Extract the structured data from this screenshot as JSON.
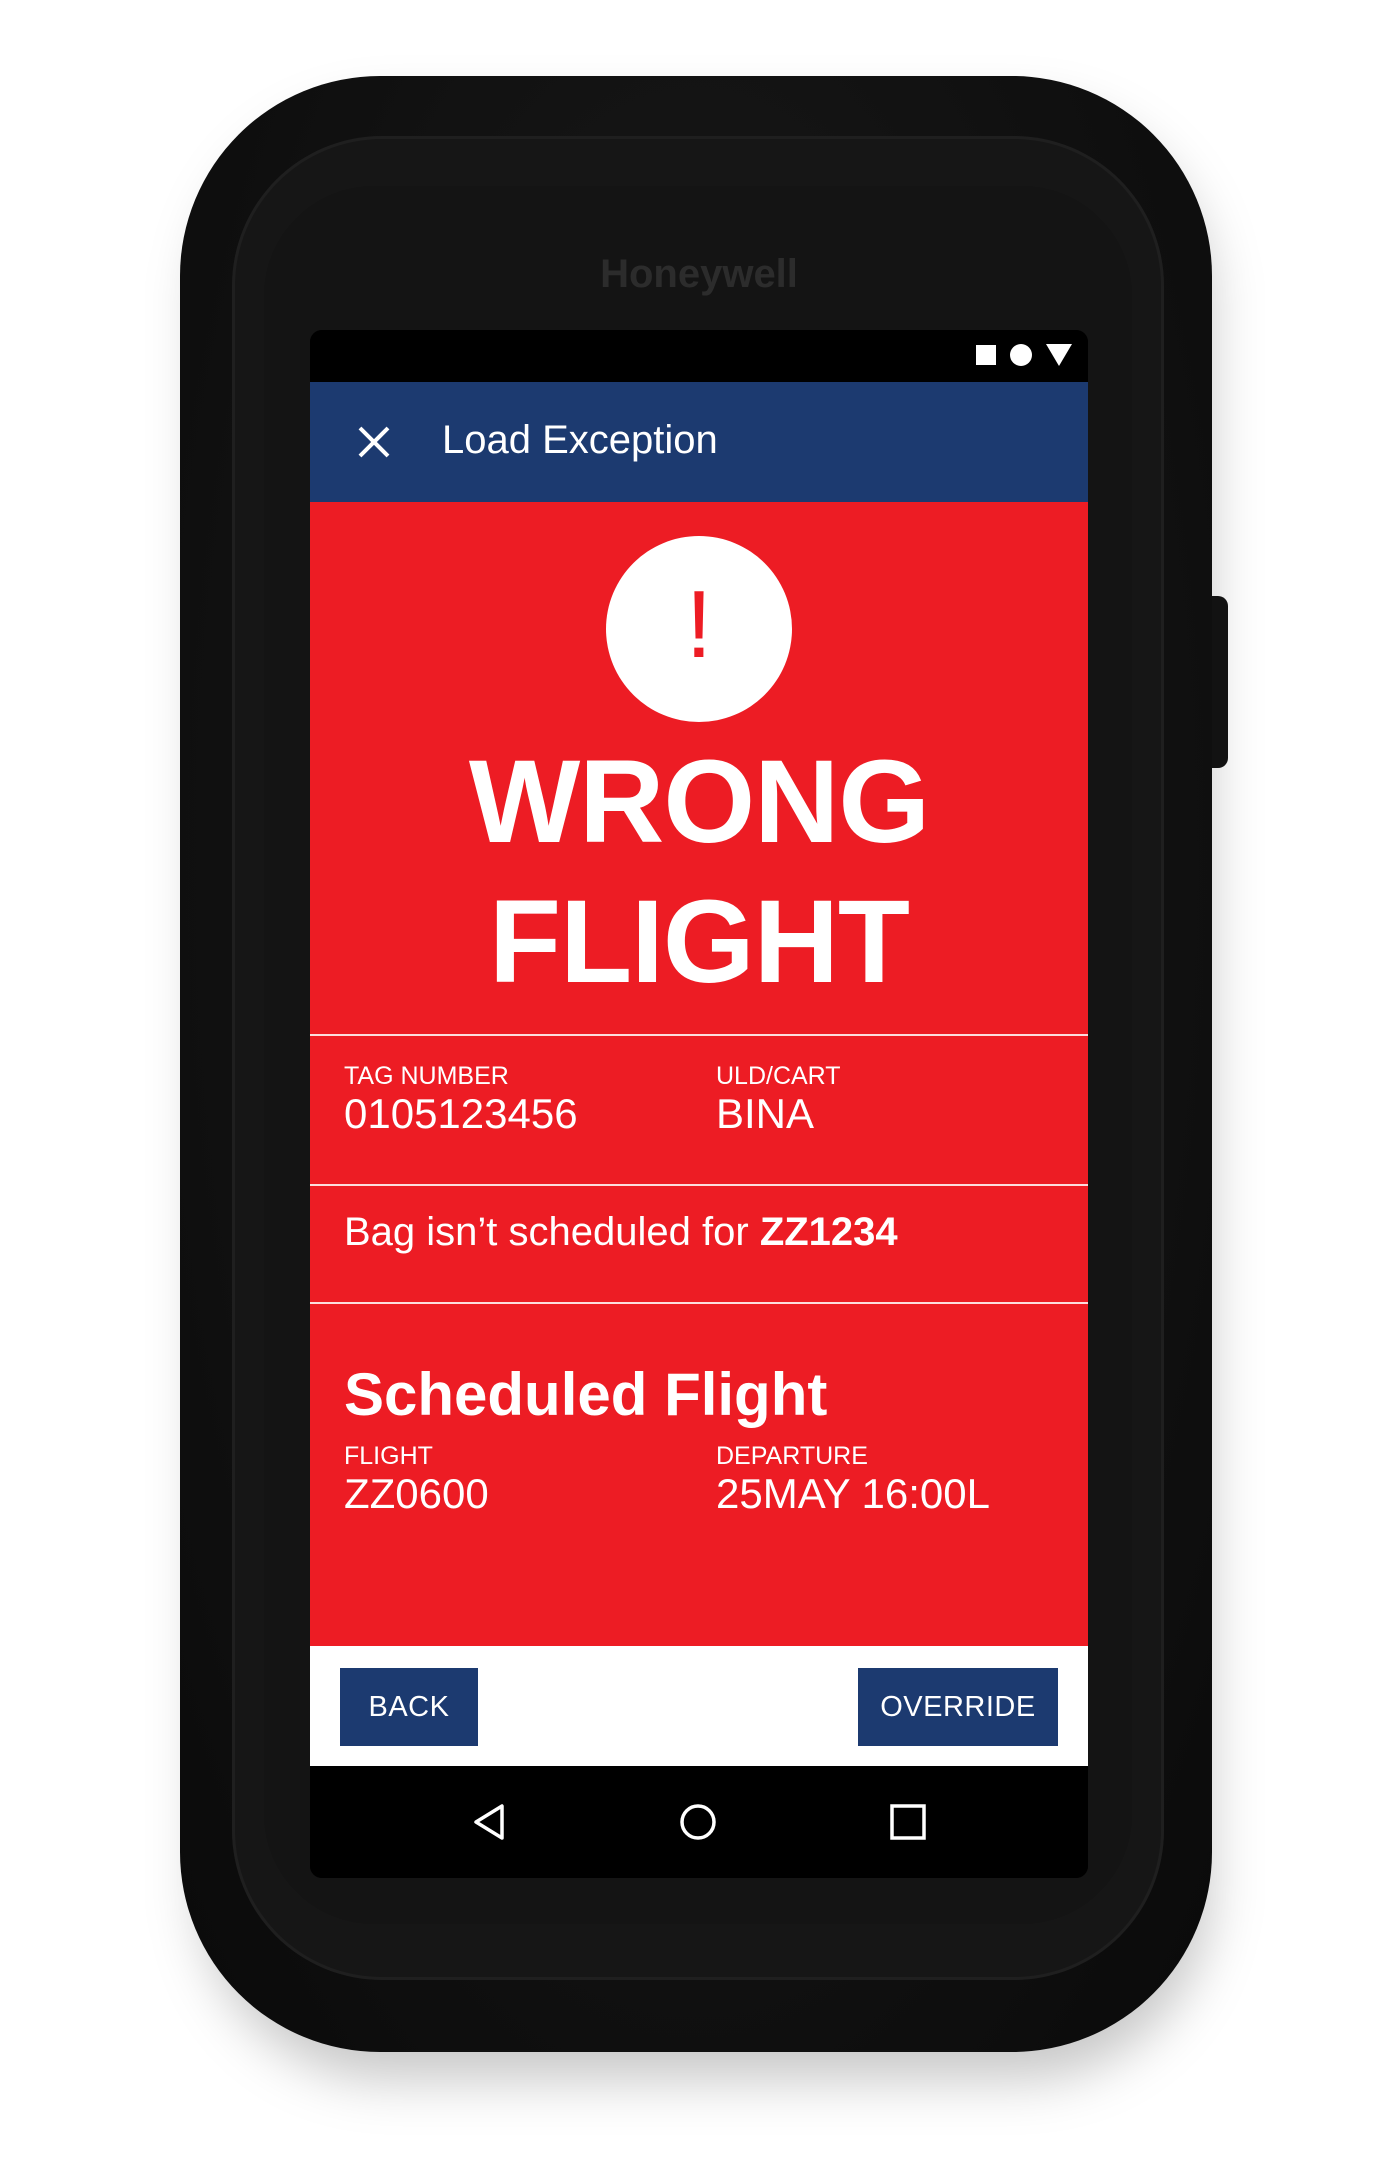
{
  "device": {
    "brand": "Honeywell"
  },
  "status_bar": {
    "icons": [
      "square-icon",
      "dot-icon",
      "triangle-icon"
    ]
  },
  "app_bar": {
    "close_icon": "close-icon",
    "title": "Load Exception"
  },
  "alert": {
    "icon_symbol": "!",
    "headline_line1": "WRONG",
    "headline_line2": "FLIGHT"
  },
  "bag_info": {
    "tag_label": "TAG NUMBER",
    "tag_value": "0105123456",
    "uld_label": "ULD/CART",
    "uld_value": "BINA"
  },
  "message": {
    "prefix": "Bag isn’t scheduled for ",
    "flight": "ZZ1234"
  },
  "scheduled_flight": {
    "title": "Scheduled Flight",
    "flight_label": "FLIGHT",
    "flight_value": "ZZ0600",
    "departure_label": "DEPARTURE",
    "departure_value": "25MAY 16:00L"
  },
  "actions": {
    "back_label": "BACK",
    "override_label": "OVERRIDE"
  },
  "nav_bar": {
    "icons": [
      "back-triangle-icon",
      "home-circle-icon",
      "recent-square-icon"
    ]
  },
  "colors": {
    "alert_red": "#ed1c24",
    "brand_navy": "#1c3a70",
    "device_black": "#111111"
  }
}
